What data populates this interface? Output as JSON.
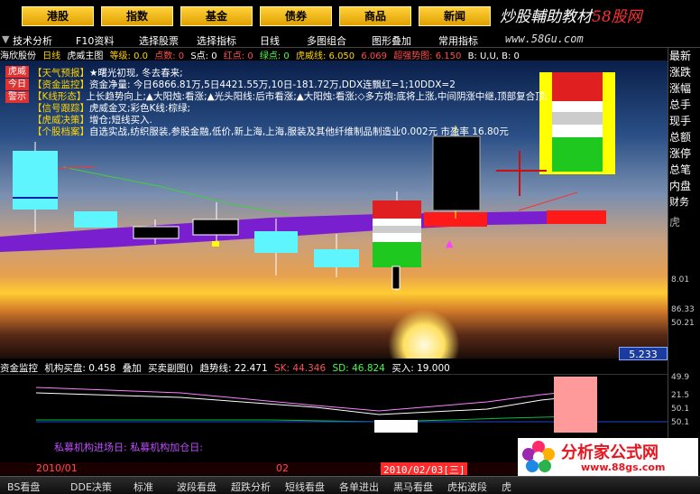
{
  "nav": {
    "items": [
      "港股",
      "指数",
      "基金",
      "债券",
      "商品",
      "新闻"
    ],
    "brand_left": "炒股輔助教材",
    "brand_right": "58股网"
  },
  "toolbar": {
    "items": [
      "技术分析",
      "F10资料",
      "选择股票",
      "选择指标",
      "日线",
      "多图组合",
      "图形叠加",
      "常用指标"
    ],
    "site": "www.58Gu.com"
  },
  "info": {
    "stock": "海欣股份",
    "period": "日线",
    "indicator": "虎威主图",
    "dengji": "等级: 0.0",
    "dianshu": "点数: 0",
    "s_point": "S点: 0",
    "red_point": "红点: 0",
    "green_point": "绿点: 0",
    "huwei": "虎威线: 6.050",
    "val2": "6.069",
    "overbuy": "超强势图: 6.150",
    "buv": "B: U,U, B: 0"
  },
  "side_tags": [
    "虎威",
    "今日",
    "警示"
  ],
  "legend": [
    {
      "tag": "【天气预报】",
      "text": "★曙光初现, 冬去春来;"
    },
    {
      "tag": "【资金监控】",
      "text": "资金净量: 今日6866.81万,5日4421.55万,10日-181.72万,DDX连飘红=1;10DDX=2"
    },
    {
      "tag": "【K线形态】",
      "text": "上长趋势向上;▲大阳烛:看涨;▲光头阳线:后市看涨;▲大阳烛:看涨;◇多方炮:底将上涨,中间阴涨中继,顶部复合顶;"
    },
    {
      "tag": "【信号跟踪】",
      "text": "虎威金叉;彩色K线:棕绿;"
    },
    {
      "tag": "【虎威决策】",
      "text": "增仓;短线买入."
    },
    {
      "tag": "【个股档案】",
      "text": "自选实战,纺织服装,参股金融,低价,新上海,上海,服装及其他纤维制品制造业0.002元 市盈率 16.80元"
    }
  ],
  "price_tag": "5.233",
  "sub": {
    "title": "资金监控",
    "jgmp": "机构买盘: 0.458",
    "dj": "叠加",
    "mmfut": "买卖副图()",
    "trend": "趋势线: 22.471",
    "sk": "SK: 44.346",
    "sd": "SD: 46.824",
    "buy": "买入: 19.000",
    "bottom_text": "私募机构进场日: 私募机构加仓日:"
  },
  "right_panel": {
    "labels": [
      "最新",
      "涨跌",
      "涨幅",
      "总手",
      "现手",
      "总额",
      "涨停",
      "总笔",
      "内盘",
      "财务"
    ],
    "tiger": "虎",
    "nums": [
      "8.01",
      "86.33",
      "50.21",
      "49.9",
      "21.5",
      "50.1",
      "50.1"
    ]
  },
  "dates": {
    "d1": "2010/01",
    "d2": "02",
    "cursor": "2010/02/03[三]"
  },
  "tabs": [
    "BS看盘",
    "DDE决策",
    "标准",
    "波段看盘",
    "超跌分析",
    "短线看盘",
    "各单进出",
    "黑马看盘",
    "虎拓波段",
    "虎"
  ],
  "logo": {
    "main": "分析家公式网",
    "url": "www.88gs.com"
  },
  "colors": {
    "accent": "#ffd23a",
    "up": "#ff2020",
    "down": "#00c8c8",
    "band": "#7a1fd0"
  }
}
